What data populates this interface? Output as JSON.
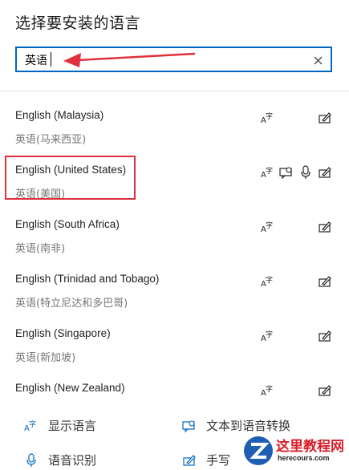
{
  "header": {
    "title": "选择要安装的语言"
  },
  "search": {
    "value": "英语"
  },
  "languages": [
    {
      "name": "English (Malaysia)",
      "native": "英语(马来西亚)",
      "features": [
        "display-language-icon",
        "handwriting-icon"
      ]
    },
    {
      "name": "English (United States)",
      "native": "英语(美国)",
      "features": [
        "display-language-icon",
        "text-to-speech-icon",
        "speech-recognition-icon",
        "handwriting-icon"
      ]
    },
    {
      "name": "English (South Africa)",
      "native": "英语(南非)",
      "features": [
        "display-language-icon",
        "handwriting-icon"
      ]
    },
    {
      "name": "English (Trinidad and Tobago)",
      "native": "英语(特立尼达和多巴哥)",
      "features": [
        "display-language-icon",
        "handwriting-icon"
      ]
    },
    {
      "name": "English (Singapore)",
      "native": "英语(新加坡)",
      "features": [
        "display-language-icon",
        "handwriting-icon"
      ]
    },
    {
      "name": "English (New Zealand)",
      "native": "",
      "features": [
        "display-language-icon",
        "handwriting-icon"
      ]
    }
  ],
  "legend": {
    "display_language": "显示语言",
    "text_to_speech": "文本到语音转换",
    "speech_recognition": "语音识别",
    "handwriting": "手写"
  },
  "watermark": {
    "title": "这里教程网",
    "url": "herecours.com"
  },
  "colors": {
    "accent": "#0067c0",
    "annotation": "#e0303c"
  }
}
